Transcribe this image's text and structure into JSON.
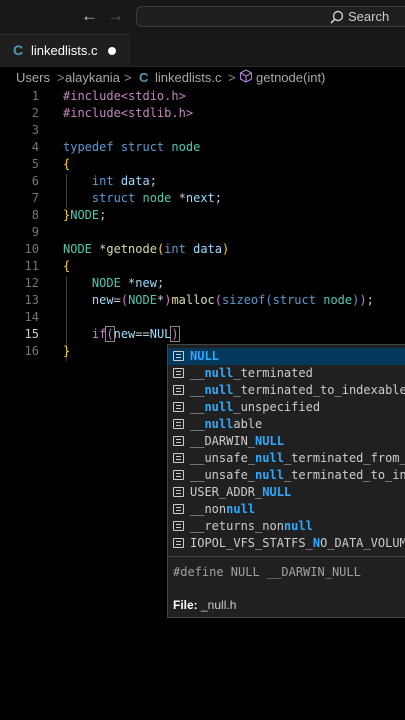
{
  "titlebar": {
    "search_label": "Search"
  },
  "tab": {
    "file_icon": "C",
    "label": "linkedlists.c"
  },
  "breadcrumb": {
    "items": [
      "Users",
      "alaykania",
      "C",
      "linkedlists.c",
      "getnode(int)"
    ],
    "separator": ">"
  },
  "editor": {
    "active_line": 15,
    "line_numbers": [
      "1",
      "2",
      "3",
      "4",
      "5",
      "6",
      "7",
      "8",
      "9",
      "10",
      "11",
      "12",
      "13",
      "14",
      "15",
      "16"
    ],
    "lines": [
      "#include<stdio.h>",
      "#include<stdlib.h>",
      "",
      "typedef struct node",
      "{",
      "    int data;",
      "    struct node *next;",
      "}NODE;",
      "",
      "NODE *getnode(int data)",
      "{",
      "    NODE *new;",
      "    new=(NODE*)malloc(sizeof(struct node));",
      "",
      "    if(new==NUL)",
      "}"
    ]
  },
  "suggestions": {
    "items": [
      {
        "pre": "",
        "match": "NULL",
        "post": ""
      },
      {
        "pre": "__",
        "match": "null",
        "post": "_terminated"
      },
      {
        "pre": "__",
        "match": "null",
        "post": "_terminated_to_indexable"
      },
      {
        "pre": "__",
        "match": "null",
        "post": "_unspecified"
      },
      {
        "pre": "__",
        "match": "null",
        "post": "able"
      },
      {
        "pre": "__DARWIN_",
        "match": "NULL",
        "post": ""
      },
      {
        "pre": "__unsafe_",
        "match": "null",
        "post": "_terminated_from_i"
      },
      {
        "pre": "__unsafe_",
        "match": "null",
        "post": "_terminated_to_ind"
      },
      {
        "pre": "USER_ADDR_",
        "match": "NULL",
        "post": ""
      },
      {
        "pre": "__non",
        "match": "null",
        "post": ""
      },
      {
        "pre": "__returns_non",
        "match": "null",
        "post": ""
      },
      {
        "pre": "IOPOL_VFS_STATFS_",
        "match": "N",
        "post": "O_DATA_VOLUME_"
      }
    ],
    "detail": "#define NULL __DARWIN_NULL",
    "file_label": "File:",
    "file_value": " _null.h"
  },
  "colors": {
    "accent": "#2aaaff",
    "selection": "#04395e",
    "background": "#000000"
  }
}
